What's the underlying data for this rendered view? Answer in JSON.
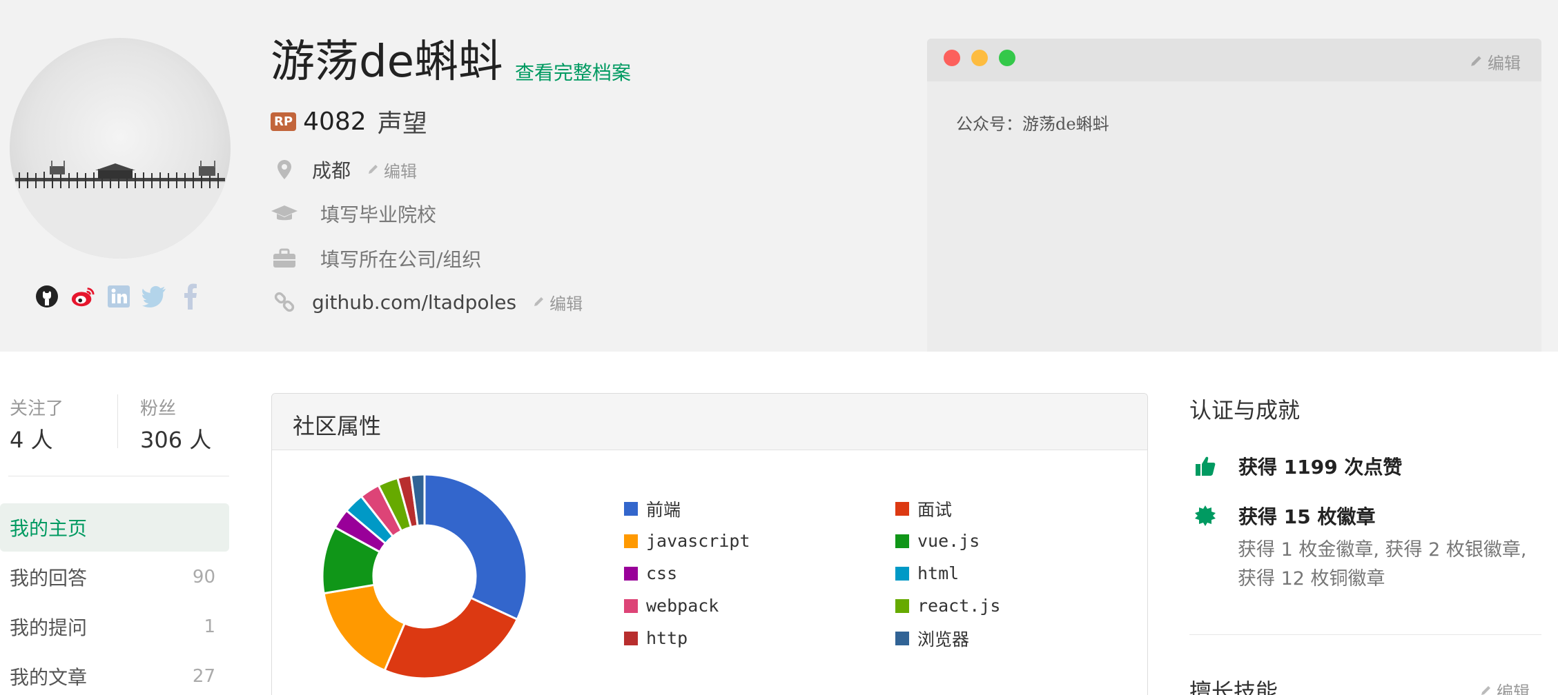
{
  "profile": {
    "name": "游荡de蝌蚪",
    "full_profile_link": "查看完整档案",
    "rp_badge": "RP",
    "reputation": "4082",
    "reputation_label": "声望",
    "location": "成都",
    "school_placeholder": "填写毕业院校",
    "company_placeholder": "填写所在公司/组织",
    "website": "github.com/ltadpoles",
    "edit_label": "编辑"
  },
  "social_icons": [
    "github-icon",
    "weibo-icon",
    "linkedin-icon",
    "twitter-icon",
    "facebook-icon"
  ],
  "note": {
    "edit_label": "编辑",
    "text": "公众号：游荡de蝌蚪",
    "window_dots": [
      "#fc605c",
      "#fdbc40",
      "#34c84a"
    ]
  },
  "stats": {
    "following_label": "关注了",
    "following_value": "4 人",
    "followers_label": "粉丝",
    "followers_value": "306 人"
  },
  "nav": [
    {
      "label": "我的主页",
      "count": ""
    },
    {
      "label": "我的回答",
      "count": "90"
    },
    {
      "label": "我的提问",
      "count": "1"
    },
    {
      "label": "我的文章",
      "count": "27"
    }
  ],
  "community": {
    "title": "社区属性"
  },
  "chart_data": {
    "type": "pie",
    "donut": true,
    "categories": [
      "前端",
      "面试",
      "javascript",
      "vue.js",
      "css",
      "html",
      "webpack",
      "react.js",
      "http",
      "浏览器"
    ],
    "values": [
      30,
      23,
      15,
      10,
      3,
      3,
      3,
      3,
      2,
      2
    ],
    "colors": [
      "#3366cc",
      "#dc3912",
      "#ff9900",
      "#109618",
      "#990099",
      "#0099c6",
      "#dd4477",
      "#66aa00",
      "#b82e2e",
      "#316395"
    ],
    "legend_position": "right"
  },
  "achievements": {
    "title": "认证与成就",
    "likes": "获得 1199 次点赞",
    "badges": "获得 15 枚徽章",
    "badge_detail": "获得 1 枚金徽章, 获得 2 枚银徽章, 获得 12 枚铜徽章",
    "skills_title": "擅长技能",
    "skills_edit": "编辑"
  },
  "colors": {
    "brand_green": "#009a61",
    "header_bg": "#f2f2f2"
  }
}
